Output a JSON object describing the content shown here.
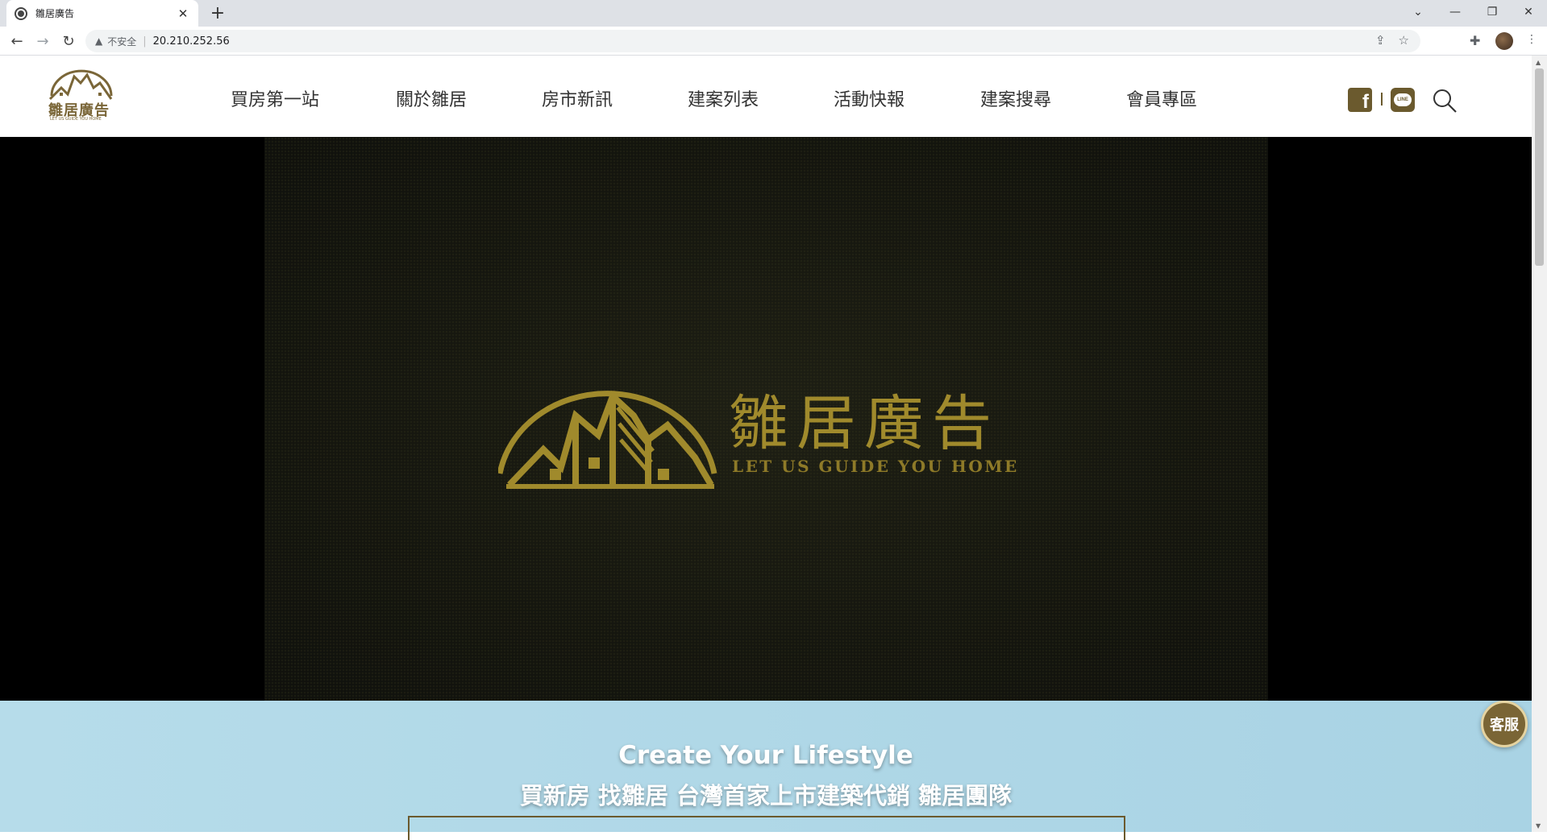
{
  "browser": {
    "tab_title": "雛居廣告",
    "tab_close": "✕",
    "new_tab": "+",
    "security_label": "不安全",
    "url": "20.210.252.56",
    "window_controls": {
      "menu": "⌄",
      "minimize": "—",
      "restore": "❐",
      "close": "✕"
    }
  },
  "header": {
    "logo_brand": "雛居廣告",
    "logo_tagline": "LET US GUIDE YOU HOME",
    "nav": [
      "買房第一站",
      "關於雛居",
      "房市新訊",
      "建案列表",
      "活動快報",
      "建案搜尋",
      "會員專區"
    ],
    "facebook_label": "f",
    "line_label": "LINE"
  },
  "hero": {
    "brand": "雛居廣告",
    "tagline": "LET US GUIDE YOU HOME"
  },
  "band": {
    "title": "Create Your Lifestyle",
    "subtitle": "買新房 找雛居 台灣首家上市建築代銷 雛居團隊"
  },
  "floating": {
    "customer_service": "客服"
  },
  "colors": {
    "brand_gold": "#6b5a2e",
    "hero_gold": "#a08a2c",
    "band_blue": "#b6dcea"
  }
}
